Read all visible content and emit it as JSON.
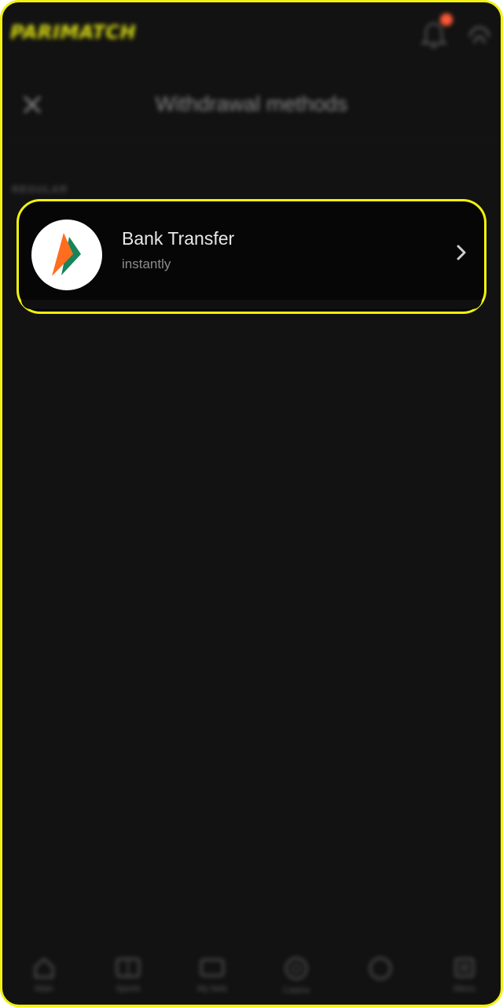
{
  "app": {
    "logo_text": "PARIMATCH",
    "brand_color": "#f2f20c",
    "notification_color": "#ff5a36"
  },
  "header": {
    "title": "Withdrawal methods",
    "close_icon": "close-icon"
  },
  "section": {
    "label": "REGULAR"
  },
  "methods": [
    {
      "name": "Bank Transfer",
      "subtitle": "instantly",
      "icon": "bank-transfer-logo",
      "highlighted": true
    }
  ],
  "bottom_nav": {
    "items": [
      {
        "label": "Main",
        "icon": "home-icon"
      },
      {
        "label": "Sports",
        "icon": "sports-icon"
      },
      {
        "label": "My bets",
        "icon": "ticket-icon"
      },
      {
        "label": "Casino",
        "icon": "casino-icon"
      },
      {
        "label": "",
        "icon": "circle-icon"
      },
      {
        "label": "Menu",
        "icon": "menu-icon"
      }
    ]
  }
}
